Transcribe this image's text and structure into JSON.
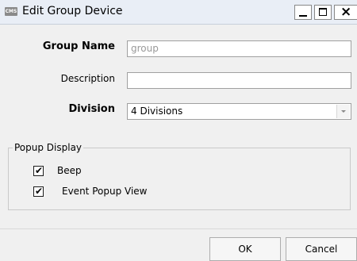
{
  "window": {
    "app_icon_text": "CMS",
    "title": "Edit Group Device",
    "controls": {
      "minimize": "_",
      "maximize": "□",
      "close": "×"
    }
  },
  "form": {
    "group_name": {
      "label": "Group Name",
      "value": "group"
    },
    "description": {
      "label": "Description",
      "value": ""
    },
    "division": {
      "label": "Division",
      "selected": "4 Divisions"
    }
  },
  "popup_display": {
    "title": "Popup Display",
    "options": [
      {
        "label": "Beep",
        "checked": true
      },
      {
        "label": "Event Popup View",
        "checked": true
      }
    ]
  },
  "buttons": {
    "ok": "OK",
    "cancel": "Cancel"
  }
}
